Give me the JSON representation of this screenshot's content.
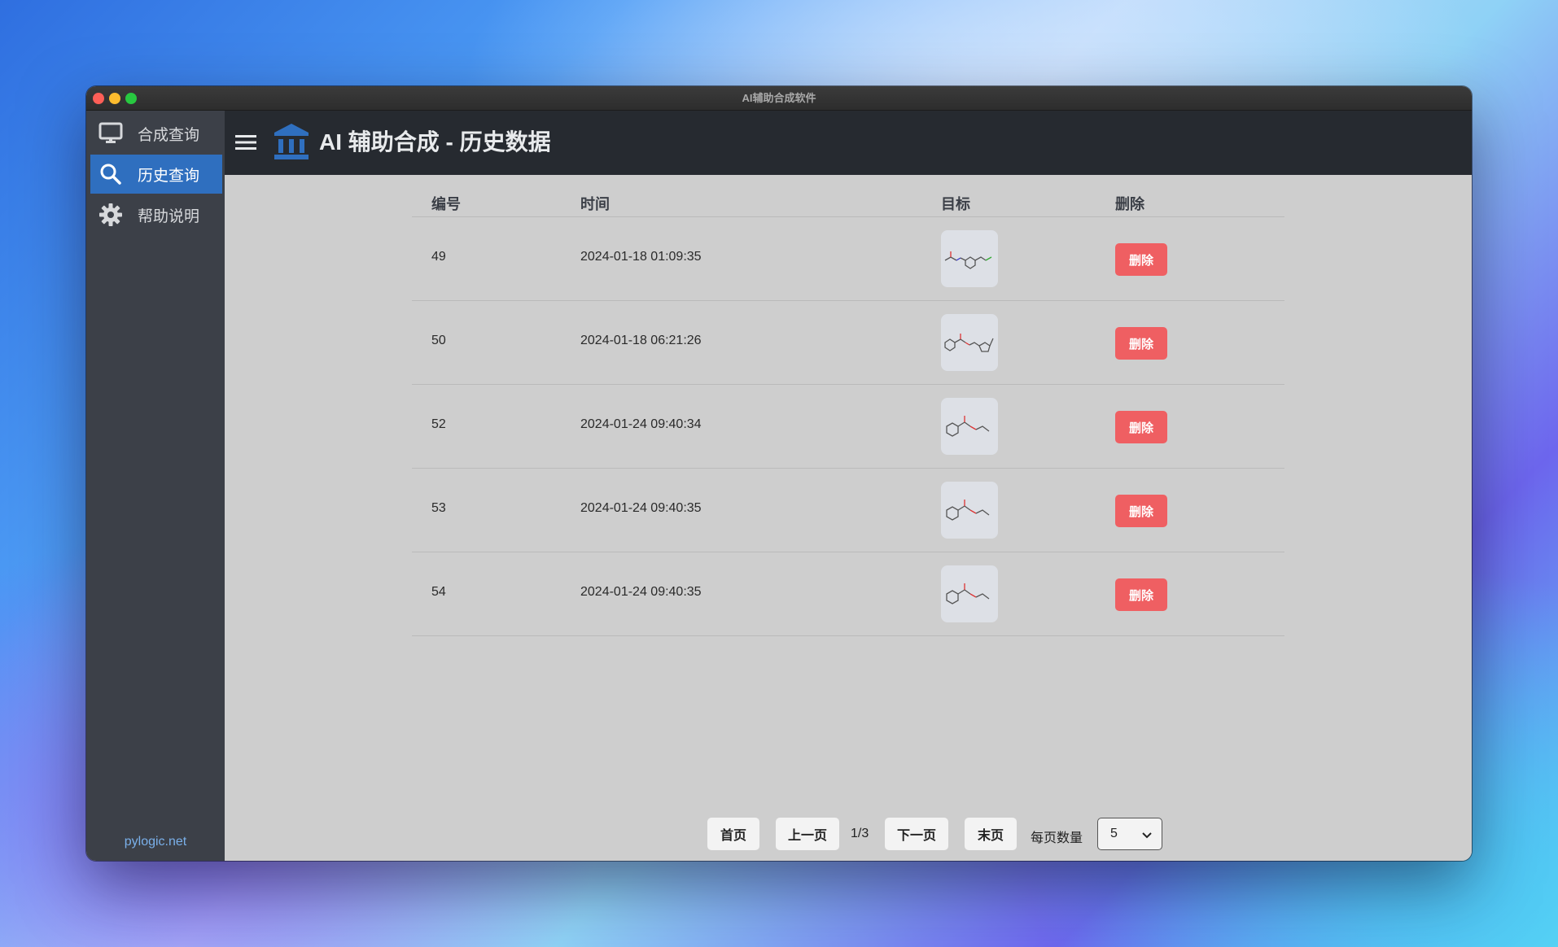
{
  "window": {
    "title": "AI辅助合成软件"
  },
  "sidebar": {
    "items": [
      {
        "label": "合成查询",
        "icon": "monitor-icon",
        "active": false
      },
      {
        "label": "历史查询",
        "icon": "search-icon",
        "active": true
      },
      {
        "label": "帮助说明",
        "icon": "gear-icon",
        "active": false
      }
    ],
    "footer": "pylogic.net"
  },
  "header": {
    "title": "AI 辅助合成 - 历史数据",
    "brand_icon": "bank-icon",
    "menu_icon": "hamburger-menu-icon"
  },
  "table": {
    "columns": [
      "编号",
      "时间",
      "目标",
      "删除"
    ],
    "rows": [
      {
        "id": "49",
        "time": "2024-01-18 01:09:35",
        "target": "molecule-structure-image",
        "delete_label": "删除"
      },
      {
        "id": "50",
        "time": "2024-01-18 06:21:26",
        "target": "molecule-structure-image",
        "delete_label": "删除"
      },
      {
        "id": "52",
        "time": "2024-01-24 09:40:34",
        "target": "molecule-structure-image",
        "delete_label": "删除"
      },
      {
        "id": "53",
        "time": "2024-01-24 09:40:35",
        "target": "molecule-structure-image",
        "delete_label": "删除"
      },
      {
        "id": "54",
        "time": "2024-01-24 09:40:35",
        "target": "molecule-structure-image",
        "delete_label": "删除"
      }
    ]
  },
  "pagination": {
    "first": "首页",
    "prev": "上一页",
    "page_indicator": "1/3",
    "next": "下一页",
    "last": "末页",
    "page_size_label": "每页数量",
    "page_size_value": "5"
  },
  "colors": {
    "accent": "#2f6fbf",
    "danger": "#ef5f62",
    "sidebar": "#3c4048",
    "header": "#262a30"
  }
}
